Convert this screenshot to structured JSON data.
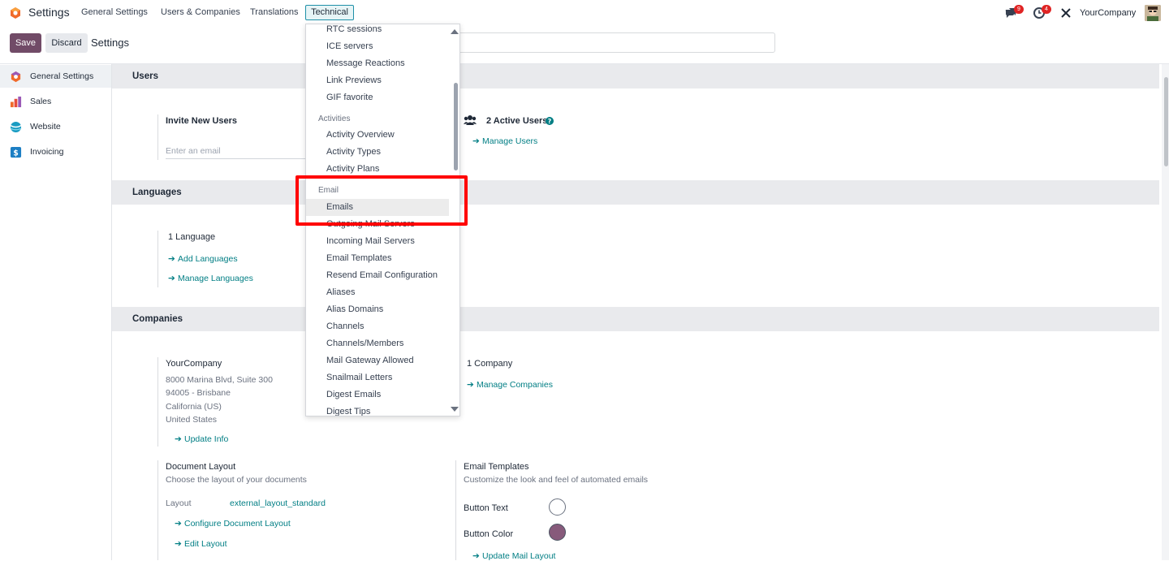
{
  "topbar": {
    "app_title": "Settings",
    "menu": [
      "General Settings",
      "Users & Companies",
      "Translations",
      "Technical"
    ],
    "messages_count": "9",
    "activities_count": "4",
    "company": "YourCompany"
  },
  "control": {
    "save": "Save",
    "discard": "Discard",
    "breadcrumb": "Settings"
  },
  "sidebar": {
    "items": [
      "General Settings",
      "Sales",
      "Website",
      "Invoicing"
    ]
  },
  "users": {
    "header": "Users",
    "invite_title": "Invite New Users",
    "email_placeholder": "Enter an email",
    "active_users": "2 Active Users",
    "manage_users": "Manage Users"
  },
  "languages": {
    "header": "Languages",
    "count": "1 Language",
    "add": "Add Languages",
    "manage": "Manage Languages"
  },
  "companies": {
    "header": "Companies",
    "name": "YourCompany",
    "address": [
      "8000 Marina Blvd, Suite 300",
      "94005 - Brisbane",
      "California (US)",
      "United States"
    ],
    "update_info": "Update Info",
    "count": "1 Company",
    "manage": "Manage Companies",
    "doc_layout_title": "Document Layout",
    "doc_layout_desc": "Choose the layout of your documents",
    "layout_label": "Layout",
    "layout_value": "external_layout_standard",
    "configure": "Configure Document Layout",
    "edit_layout": "Edit Layout",
    "email_tpl_title": "Email Templates",
    "email_tpl_desc": "Customize the look and feel of automated emails",
    "button_text": "Button Text",
    "button_color": "Button Color",
    "update_mail": "Update Mail Layout",
    "button_text_color": "#ffffff",
    "button_color_value": "#875a7b"
  },
  "dropdown": {
    "top_items": [
      "RTC sessions",
      "ICE servers",
      "Message Reactions",
      "Link Previews",
      "GIF favorite"
    ],
    "activities_header": "Activities",
    "activities_items": [
      "Activity Overview",
      "Activity Types",
      "Activity Plans"
    ],
    "email_header": "Email",
    "emails": "Emails",
    "partially_hidden": "Outgoing Mail Servers",
    "email_items": [
      "Incoming Mail Servers",
      "Email Templates",
      "Resend Email Configuration",
      "Aliases",
      "Alias Domains",
      "Channels",
      "Channels/Members",
      "Mail Gateway Allowed",
      "Snailmail Letters",
      "Digest Emails",
      "Digest Tips"
    ]
  },
  "colors": {
    "brand": "#714b67",
    "link": "#017e84",
    "highlight_box": "#ff0000"
  }
}
